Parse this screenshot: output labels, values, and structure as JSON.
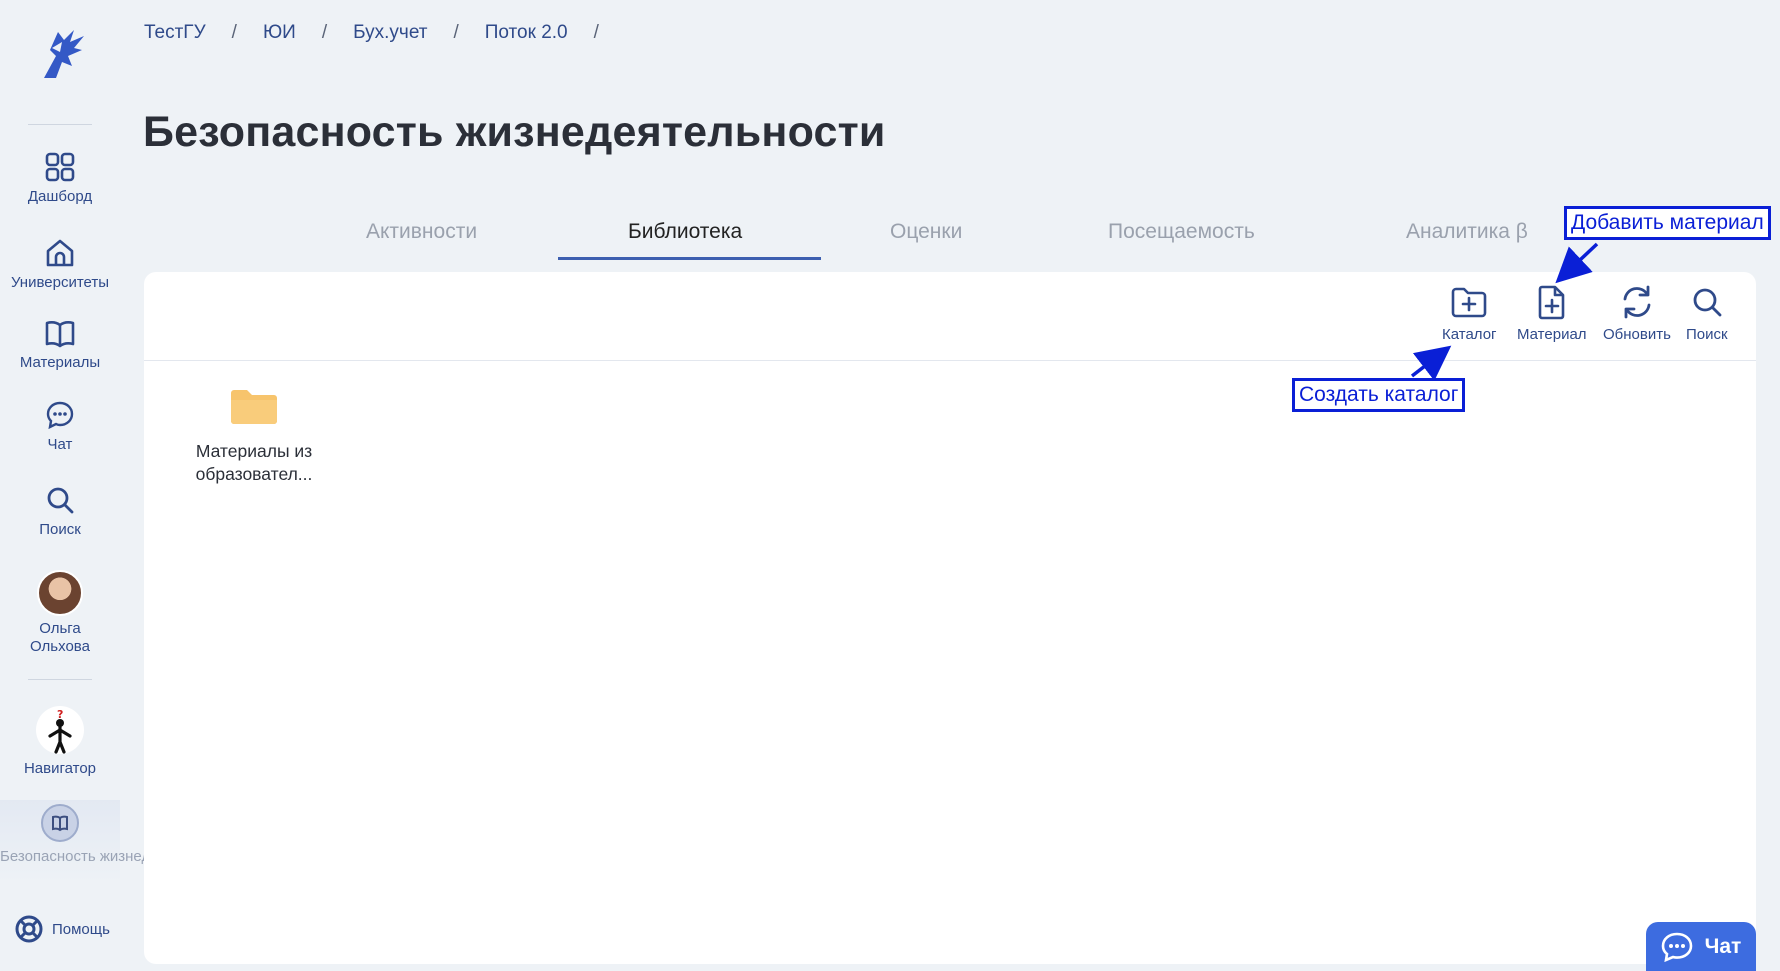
{
  "breadcrumb": [
    "ТестГУ",
    "ЮИ",
    "Бух.учет",
    "Поток 2.0"
  ],
  "breadcrumb_separator": "/",
  "page_title": "Безопасность жизнедеятельности",
  "sidebar": {
    "items": [
      {
        "label": "Дашборд",
        "icon": "grid-icon"
      },
      {
        "label": "Университеты",
        "icon": "university-icon"
      },
      {
        "label": "Материалы",
        "icon": "book-icon"
      },
      {
        "label": "Чат",
        "icon": "chat-bubble-icon"
      },
      {
        "label": "Поиск",
        "icon": "search-icon"
      }
    ],
    "user": {
      "first_name": "Ольга",
      "last_name": "Ольхова"
    },
    "navigator_label": "Навигатор",
    "course_label": "Безопасность жизнедеятельн",
    "help_label": "Помощь"
  },
  "tabs": [
    {
      "label": "Активности",
      "active": false
    },
    {
      "label": "Библиотека",
      "active": true
    },
    {
      "label": "Оценки",
      "active": false
    },
    {
      "label": "Посещаемость",
      "active": false
    },
    {
      "label": "Аналитика β",
      "active": false
    }
  ],
  "toolbar": {
    "catalog_label": "Каталог",
    "material_label": "Материал",
    "refresh_label": "Обновить",
    "search_label": "Поиск"
  },
  "library_items": [
    {
      "type": "folder",
      "name_line1": "Материалы из",
      "name_line2": "образовател..."
    }
  ],
  "annotations": {
    "add_material": "Добавить материал",
    "create_catalog": "Создать каталог"
  },
  "chat_button_label": "Чат",
  "colors": {
    "accent": "#3d5fb0",
    "nav_text": "#2f4a8a",
    "folder": "#f7c46c",
    "annotation": "#0a1fd6",
    "chat_button": "#3d6ce0"
  }
}
